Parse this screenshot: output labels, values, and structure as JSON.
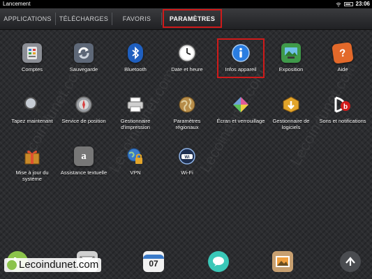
{
  "status_bar": {
    "title": "Lancement",
    "time": "23:06"
  },
  "tabs": [
    {
      "label": "APPLICATIONS"
    },
    {
      "label": "TÉLÉCHARGES"
    },
    {
      "label": "FAVORIS"
    },
    {
      "label": "PARAMÈTRES"
    }
  ],
  "apps": [
    {
      "label": "Comptes",
      "icon": "accounts-icon",
      "color": "#8c8f96"
    },
    {
      "label": "Sauvegarde",
      "icon": "backup-icon",
      "color": "#6f7a8c"
    },
    {
      "label": "Bluetooth",
      "icon": "bluetooth-icon",
      "color": "#1f5fbf"
    },
    {
      "label": "Date et heure",
      "icon": "clock-icon",
      "color": "#d8d8d8"
    },
    {
      "label": "Infos appareil",
      "icon": "info-icon",
      "color": "#2a7de1"
    },
    {
      "label": "Exposition",
      "icon": "exhibition-icon",
      "color": "#3f9a4a"
    },
    {
      "label": "Aide",
      "icon": "help-icon",
      "color": "#e3692a"
    },
    {
      "label": "Tapez maintenant",
      "icon": "search-icon",
      "color": "#777b82"
    },
    {
      "label": "Service de position",
      "icon": "location-icon",
      "color": "#8d8f93"
    },
    {
      "label": "Gestionnaire d'impression",
      "icon": "printer-icon",
      "color": "#b9b9b9"
    },
    {
      "label": "Paramètres régionaux",
      "icon": "globe-icon",
      "color": "#b68c49"
    },
    {
      "label": "Écran et verrouillage",
      "icon": "screen-lock-icon",
      "color": "#6fa0d8"
    },
    {
      "label": "Gestionnaire de logiciels",
      "icon": "software-manager-icon",
      "color": "#e3a52a"
    },
    {
      "label": "Sons et notifications",
      "icon": "sound-icon",
      "color": "#ffffff"
    },
    {
      "label": "Mise à jour du système",
      "icon": "gift-update-icon",
      "color": "#c98a2a"
    },
    {
      "label": "Assistance textuelle",
      "icon": "text-assist-icon",
      "color": "#888888"
    },
    {
      "label": "VPN",
      "icon": "vpn-globe-icon",
      "color": "#3a7ac8"
    },
    {
      "label": "Wi-Fi",
      "icon": "wifi-icon",
      "color": "#3a6fb0"
    }
  ],
  "dock": [
    {
      "icon": "phone-icon"
    },
    {
      "icon": "email-icon"
    },
    {
      "icon": "calendar-icon",
      "text": "07"
    },
    {
      "icon": "messaging-icon"
    },
    {
      "icon": "photos-icon"
    },
    {
      "icon": "launcher-up-icon"
    }
  ],
  "brand": {
    "text": "Lecoindunet.com"
  },
  "watermark": "Lecoindunet.com"
}
